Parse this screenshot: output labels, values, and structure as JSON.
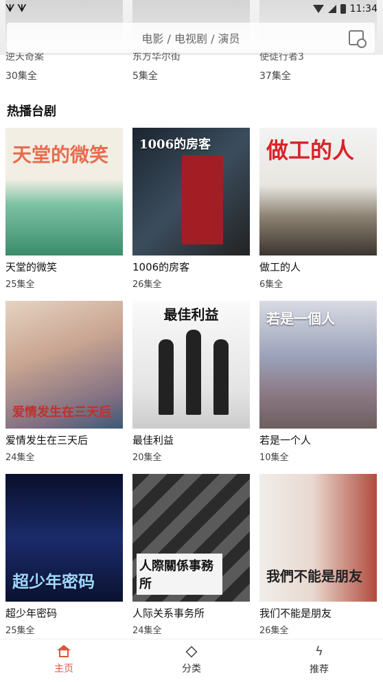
{
  "status_bar": {
    "time": "11:34"
  },
  "search": {
    "placeholder": "电影 / 电视剧 / 演员"
  },
  "top_row": [
    {
      "title": "逆天奇案",
      "episodes": "30集全"
    },
    {
      "title": "东方华尔街",
      "episodes": "5集全"
    },
    {
      "title": "使徒行者3",
      "episodes": "37集全"
    }
  ],
  "section": {
    "title": "热播台剧"
  },
  "shows": [
    {
      "title": "天堂的微笑",
      "episodes": "25集全",
      "poster_text": "天堂的微笑"
    },
    {
      "title": "1006的房客",
      "episodes": "26集全",
      "poster_text": "1006的房客"
    },
    {
      "title": "做工的人",
      "episodes": "6集全",
      "poster_text": "做工的人"
    },
    {
      "title": "爱情发生在三天后",
      "episodes": "24集全",
      "poster_text": "爱情发生在三天后"
    },
    {
      "title": "最佳利益",
      "episodes": "20集全",
      "poster_text": "最佳利益"
    },
    {
      "title": "若是一个人",
      "episodes": "10集全",
      "poster_text": "若是一個人"
    },
    {
      "title": "超少年密码",
      "episodes": "25集全",
      "poster_text": "超少年密码"
    },
    {
      "title": "人际关系事务所",
      "episodes": "24集全",
      "poster_text": "人際關係事務所"
    },
    {
      "title": "我们不能是朋友",
      "episodes": "26集全",
      "poster_text": "我們不能是朋友"
    }
  ],
  "nav": {
    "home": "主页",
    "category": "分类",
    "recommend": "推荐"
  },
  "colors": {
    "accent": "#e0533c"
  }
}
